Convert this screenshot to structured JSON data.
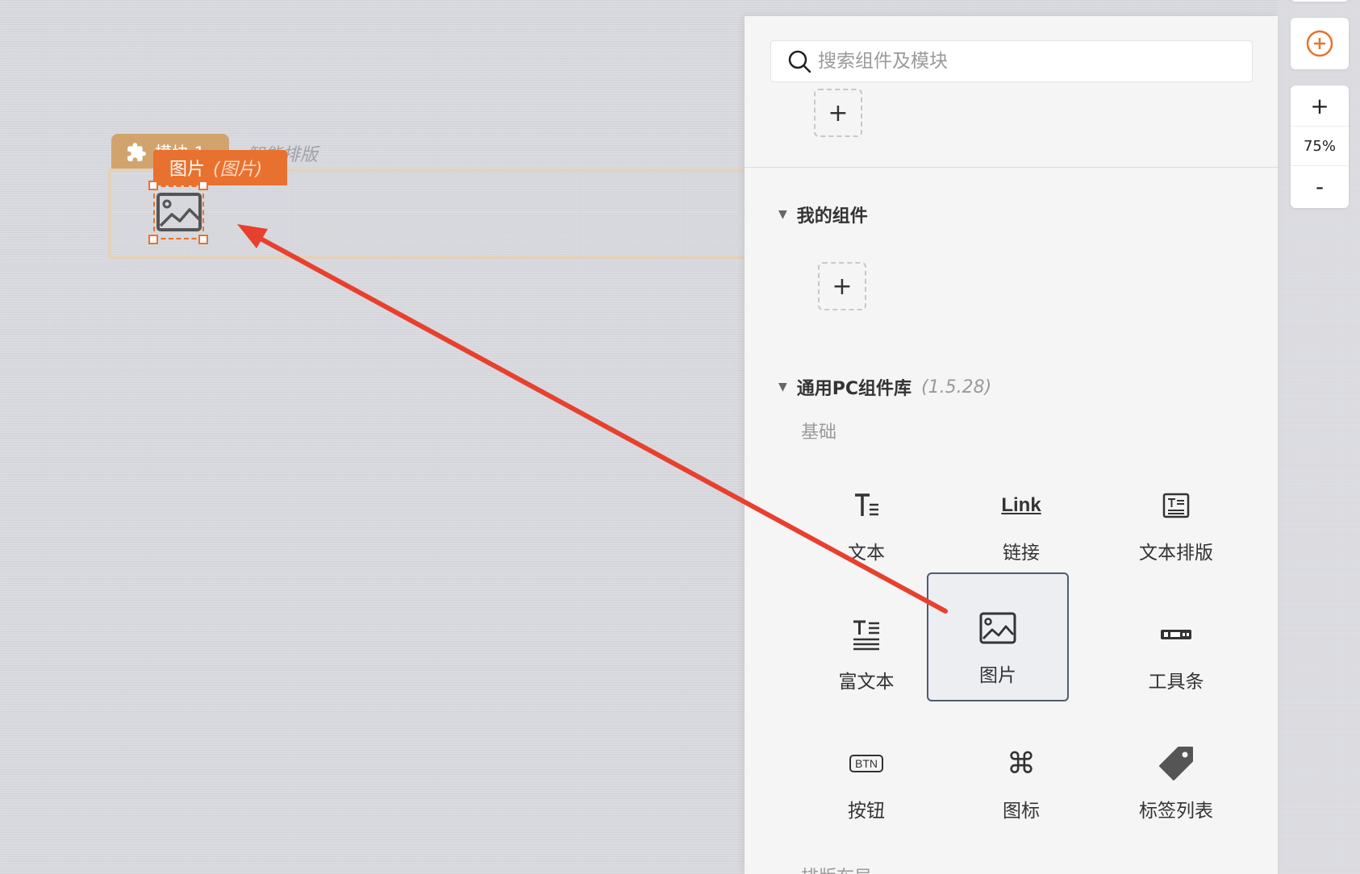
{
  "canvas": {
    "module_tab_label": "模块 1",
    "module_caption": "智能排版",
    "selected_label": "图片",
    "selected_kind": "(图片)"
  },
  "panel": {
    "search_placeholder": "搜索组件及模块",
    "add_symbol": "+",
    "my_components_title": "我的组件",
    "library_title": "通用PC组件库",
    "library_version": "(1.5.28)",
    "basic_group": "基础",
    "layout_group": "排版布局",
    "components": [
      {
        "label": "文本",
        "icon": "text-icon"
      },
      {
        "label": "链接",
        "icon": "link-icon",
        "icon_text": "Link"
      },
      {
        "label": "文本排版",
        "icon": "text-layout-icon"
      },
      {
        "label": "富文本",
        "icon": "rich-text-icon"
      },
      {
        "label": "图片",
        "icon": "image-icon",
        "selected": true
      },
      {
        "label": "工具条",
        "icon": "toolbar-icon"
      },
      {
        "label": "按钮",
        "icon": "button-icon",
        "icon_text": "BTN"
      },
      {
        "label": "图标",
        "icon": "command-icon"
      },
      {
        "label": "标签列表",
        "icon": "tag-icon"
      }
    ]
  },
  "toolbar": {
    "zoom_in": "+",
    "zoom_level": "75%",
    "zoom_out": "-"
  },
  "colors": {
    "accent": "#e9712f",
    "module": "#d2a46d",
    "arrow": "#e8402e",
    "selected_border": "#4f5a72"
  }
}
